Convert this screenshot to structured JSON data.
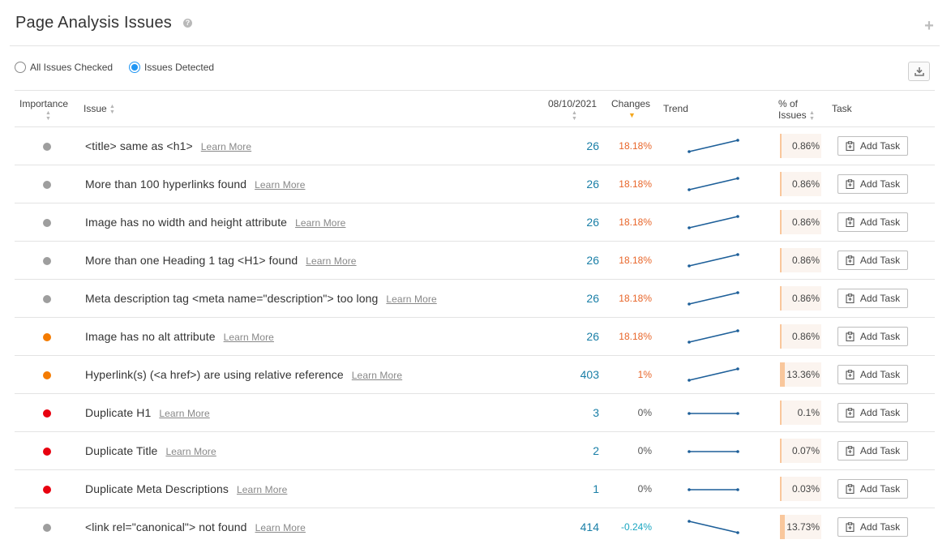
{
  "header": {
    "title": "Page Analysis Issues",
    "help_glyph": "?",
    "add_glyph": "+"
  },
  "filters": {
    "all_label": "All Issues Checked",
    "detected_label": "Issues Detected",
    "selected": "detected"
  },
  "columns": {
    "importance": "Importance",
    "issue": "Issue",
    "date": "08/10/2021",
    "changes": "Changes",
    "trend": "Trend",
    "pct_line1": "% of",
    "pct_line2": "Issues",
    "task": "Task"
  },
  "colors": {
    "gray": "#9e9e9e",
    "orange": "#f47b00",
    "red": "#e8000f",
    "link": "#1a7fa7",
    "up": "#e8662a",
    "down": "#19a6c1",
    "trend": "#1d5f99"
  },
  "task_label": "Add Task",
  "learn_label": "Learn More",
  "rows": [
    {
      "importance": "gray",
      "issue": "<title> same as <h1>",
      "count": "26",
      "change": "18.18%",
      "change_dir": "up",
      "trend": [
        25,
        26
      ],
      "pct": "0.86%",
      "pct_value": 0.86
    },
    {
      "importance": "gray",
      "issue": "More than 100 hyperlinks found",
      "count": "26",
      "change": "18.18%",
      "change_dir": "up",
      "trend": [
        25,
        26
      ],
      "pct": "0.86%",
      "pct_value": 0.86
    },
    {
      "importance": "gray",
      "issue": "Image has no width and height attribute",
      "count": "26",
      "change": "18.18%",
      "change_dir": "up",
      "trend": [
        25,
        26
      ],
      "pct": "0.86%",
      "pct_value": 0.86
    },
    {
      "importance": "gray",
      "issue": "More than one Heading 1 tag <H1> found",
      "count": "26",
      "change": "18.18%",
      "change_dir": "up",
      "trend": [
        25,
        26
      ],
      "pct": "0.86%",
      "pct_value": 0.86
    },
    {
      "importance": "gray",
      "issue": "Meta description tag <meta name=\"description\"> too long",
      "count": "26",
      "change": "18.18%",
      "change_dir": "up",
      "trend": [
        25,
        26
      ],
      "pct": "0.86%",
      "pct_value": 0.86
    },
    {
      "importance": "orange",
      "issue": "Image has no alt attribute",
      "count": "26",
      "change": "18.18%",
      "change_dir": "up",
      "trend": [
        25,
        26
      ],
      "pct": "0.86%",
      "pct_value": 0.86
    },
    {
      "importance": "orange",
      "issue": "Hyperlink(s) (<a href>) are using relative reference",
      "count": "403",
      "change": "1%",
      "change_dir": "up",
      "trend": [
        25,
        26
      ],
      "pct": "13.36%",
      "pct_value": 13.36
    },
    {
      "importance": "red",
      "issue": "Duplicate H1",
      "count": "3",
      "change": "0%",
      "change_dir": "flat",
      "trend": [
        26,
        26
      ],
      "pct": "0.1%",
      "pct_value": 0.1
    },
    {
      "importance": "red",
      "issue": "Duplicate Title",
      "count": "2",
      "change": "0%",
      "change_dir": "flat",
      "trend": [
        26,
        26
      ],
      "pct": "0.07%",
      "pct_value": 0.07
    },
    {
      "importance": "red",
      "issue": "Duplicate Meta Descriptions",
      "count": "1",
      "change": "0%",
      "change_dir": "flat",
      "trend": [
        26,
        26
      ],
      "pct": "0.03%",
      "pct_value": 0.03
    },
    {
      "importance": "gray",
      "issue": "<link rel=\"canonical\"> not found",
      "count": "414",
      "change": "-0.24%",
      "change_dir": "down",
      "trend": [
        26,
        25
      ],
      "pct": "13.73%",
      "pct_value": 13.73
    }
  ]
}
